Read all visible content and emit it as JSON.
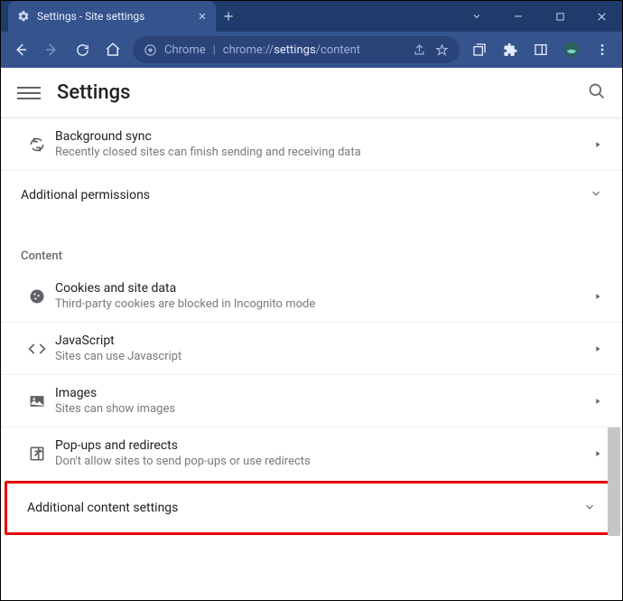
{
  "window": {
    "tab_title": "Settings - Site settings"
  },
  "omnibox": {
    "host_label": "Chrome",
    "url_prefix": "chrome://",
    "url_bold": "settings",
    "url_suffix": "/content"
  },
  "header": {
    "title": "Settings"
  },
  "sections": {
    "top_rows": [
      {
        "title": "Background sync",
        "sub": "Recently closed sites can finish sending and receiving data"
      }
    ],
    "additional_permissions_label": "Additional permissions",
    "content_label": "Content",
    "content_rows": [
      {
        "title": "Cookies and site data",
        "sub": "Third-party cookies are blocked in Incognito mode"
      },
      {
        "title": "JavaScript",
        "sub": "Sites can use Javascript"
      },
      {
        "title": "Images",
        "sub": "Sites can show images"
      },
      {
        "title": "Pop-ups and redirects",
        "sub": "Don't allow sites to send pop-ups or use redirects"
      }
    ],
    "additional_content_label": "Additional content settings"
  }
}
